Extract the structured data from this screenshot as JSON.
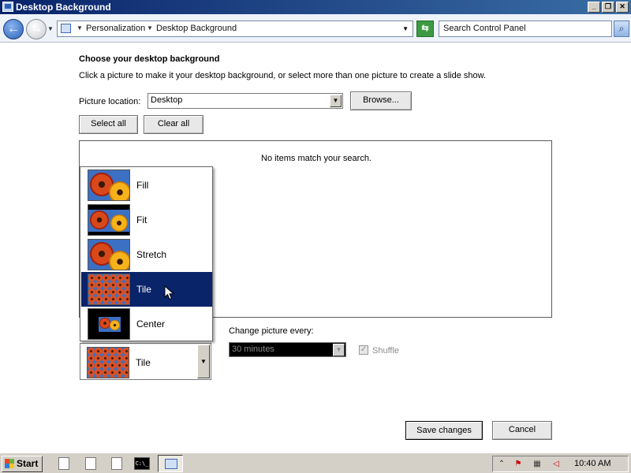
{
  "window": {
    "title": "Desktop Background",
    "buttons": {
      "minimize": "_",
      "restore": "❐",
      "close": "✕"
    }
  },
  "address": {
    "breadcrumb": [
      "Personalization",
      "Desktop Background"
    ],
    "search_placeholder": "Search Control Panel"
  },
  "main": {
    "heading": "Choose your desktop background",
    "instruction": "Click a picture to make it your desktop background, or select more than one picture to create a slide show.",
    "picture_location_label": "Picture location:",
    "picture_location_value": "Desktop",
    "browse_label": "Browse...",
    "select_all_label": "Select all",
    "clear_all_label": "Clear all",
    "empty_message": "No items match your search."
  },
  "position": {
    "selected": "Tile",
    "options": [
      "Fill",
      "Fit",
      "Stretch",
      "Tile",
      "Center"
    ],
    "highlighted_index": 3
  },
  "slideshow": {
    "change_label": "Change picture every:",
    "interval_value": "30 minutes",
    "shuffle_label": "Shuffle",
    "shuffle_checked": true,
    "disabled": true
  },
  "footer": {
    "save_label": "Save changes",
    "cancel_label": "Cancel"
  },
  "taskbar": {
    "start_label": "Start",
    "cmd_label": "C:\\_",
    "clock": "10:40 AM"
  },
  "colors": {
    "selection": "#0a246a",
    "titlebar_start": "#0a246a",
    "titlebar_end": "#3a6ea5",
    "taskbar": "#d4d0c8"
  }
}
